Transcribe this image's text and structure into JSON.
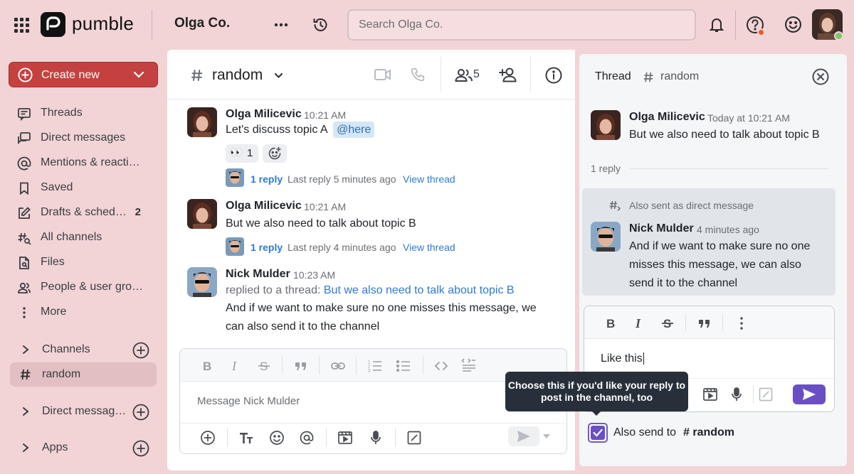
{
  "app": {
    "name": "pumble",
    "workspace": "Olga Co."
  },
  "search": {
    "placeholder": "Search Olga Co."
  },
  "sidebar": {
    "create_label": "Create new",
    "items": [
      {
        "label": "Threads",
        "icon": "threads-icon"
      },
      {
        "label": "Direct messages",
        "icon": "dm-icon"
      },
      {
        "label": "Mentions & reacti…",
        "icon": "at-icon"
      },
      {
        "label": "Saved",
        "icon": "bookmark-icon"
      },
      {
        "label": "Drafts & sched…",
        "icon": "edit-icon",
        "badge": "2"
      },
      {
        "label": "All channels",
        "icon": "channels-search-icon"
      },
      {
        "label": "Files",
        "icon": "file-icon"
      },
      {
        "label": "People & user gro…",
        "icon": "people-icon"
      },
      {
        "label": "More",
        "icon": "more-vertical-icon"
      }
    ],
    "channels_label": "Channels",
    "channel_active": "random",
    "dm_label": "Direct messag…",
    "apps_label": "Apps"
  },
  "channel": {
    "name": "random",
    "member_count": "5"
  },
  "messages": [
    {
      "author": "Olga Milicevic",
      "time": "10:21 AM",
      "text": "Let's discuss topic A",
      "mention": "@here",
      "reaction_emoji": "👀",
      "reaction_count": "1",
      "reply_count": "1 reply",
      "last_reply": "Last reply 5 minutes ago",
      "view_thread": "View thread"
    },
    {
      "author": "Olga Milicevic",
      "time": "10:21 AM",
      "text": "But we also need to talk about topic B",
      "reply_count": "1 reply",
      "last_reply": "Last reply 4 minutes ago",
      "view_thread": "View thread"
    },
    {
      "author": "Nick Mulder",
      "time": "10:23 AM",
      "replied_prefix": "replied to a thread:",
      "replied_link": "But we also need to talk about topic B",
      "text_line1": "And if we want to make sure no one misses this message, we",
      "text_line2": "can also send it to the channel"
    }
  ],
  "composer": {
    "placeholder": "Message Nick Mulder"
  },
  "thread": {
    "title": "Thread",
    "channel": "random",
    "root": {
      "author": "Olga Milicevic",
      "time": "Today at 10:21 AM",
      "text": "But we also need to talk about topic B"
    },
    "reply_count": "1 reply",
    "dm_note": "Also sent as direct message",
    "reply": {
      "author": "Nick Mulder",
      "time": "4 minutes ago",
      "line1": "And if we want to make sure no one",
      "line2": "misses this message, we can also",
      "line3": "send it to the channel"
    },
    "composer_value": "Like this",
    "tooltip_line1": "Choose this if you'd like your reply to",
    "tooltip_line2": "post in the channel, too",
    "also_send_label": "Also send to",
    "also_send_channel": "# random",
    "also_send_checked": true
  },
  "colors": {
    "accent": "#c5413f",
    "sidebar_bg": "#f2d4d6",
    "link": "#2f7ad1",
    "checkbox": "#6a4fc4"
  }
}
